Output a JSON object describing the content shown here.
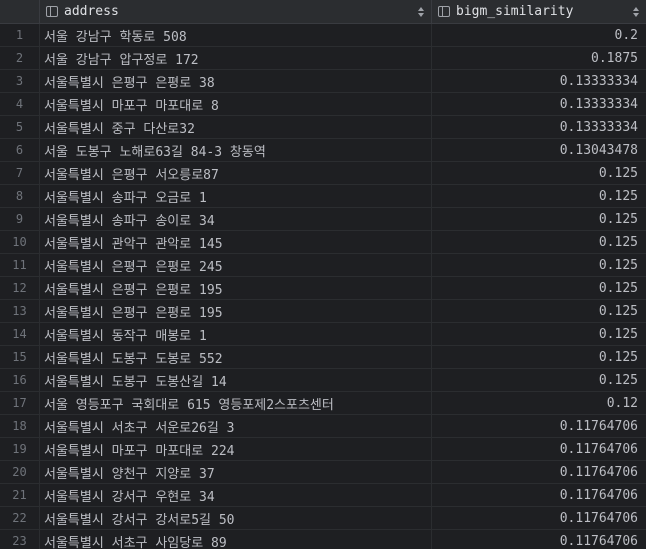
{
  "columns": {
    "address": "address",
    "similarity": "bigm_similarity"
  },
  "rows": [
    {
      "n": "1",
      "address": "서울 강남구 학동로 508",
      "sim": "0.2"
    },
    {
      "n": "2",
      "address": "서울 강남구 압구정로 172",
      "sim": "0.1875"
    },
    {
      "n": "3",
      "address": "서울특별시 은평구 은평로 38",
      "sim": "0.13333334"
    },
    {
      "n": "4",
      "address": "서울특별시 마포구 마포대로 8",
      "sim": "0.13333334"
    },
    {
      "n": "5",
      "address": "서울특별시 중구 다산로32",
      "sim": "0.13333334"
    },
    {
      "n": "6",
      "address": "서울 도봉구 노해로63길 84-3 창동역",
      "sim": "0.13043478"
    },
    {
      "n": "7",
      "address": "서울특별시 은평구 서오릉로87",
      "sim": "0.125"
    },
    {
      "n": "8",
      "address": "서울특별시 송파구 오금로 1",
      "sim": "0.125"
    },
    {
      "n": "9",
      "address": "서울특별시 송파구 송이로 34",
      "sim": "0.125"
    },
    {
      "n": "10",
      "address": "서울특별시 관악구 관악로 145",
      "sim": "0.125"
    },
    {
      "n": "11",
      "address": "서울특별시 은평구 은평로 245",
      "sim": "0.125"
    },
    {
      "n": "12",
      "address": "서울특별시 은평구 은평로 195",
      "sim": "0.125"
    },
    {
      "n": "13",
      "address": "서울특별시 은평구 은평로 195",
      "sim": "0.125"
    },
    {
      "n": "14",
      "address": "서울특별시 동작구 매봉로 1",
      "sim": "0.125"
    },
    {
      "n": "15",
      "address": "서울특별시 도봉구 도봉로 552",
      "sim": "0.125"
    },
    {
      "n": "16",
      "address": "서울특별시 도봉구 도봉산길 14",
      "sim": "0.125"
    },
    {
      "n": "17",
      "address": "서울 영등포구 국회대로 615 영등포제2스포츠센터",
      "sim": "0.12"
    },
    {
      "n": "18",
      "address": "서울특별시 서초구 서운로26길 3",
      "sim": "0.11764706"
    },
    {
      "n": "19",
      "address": "서울특별시 마포구 마포대로 224",
      "sim": "0.11764706"
    },
    {
      "n": "20",
      "address": "서울특별시 양천구 지양로 37",
      "sim": "0.11764706"
    },
    {
      "n": "21",
      "address": "서울특별시 강서구 우현로 34",
      "sim": "0.11764706"
    },
    {
      "n": "22",
      "address": "서울특별시 강서구 강서로5길 50",
      "sim": "0.11764706"
    },
    {
      "n": "23",
      "address": "서울특별시 서초구 사임당로 89",
      "sim": "0.11764706"
    }
  ]
}
